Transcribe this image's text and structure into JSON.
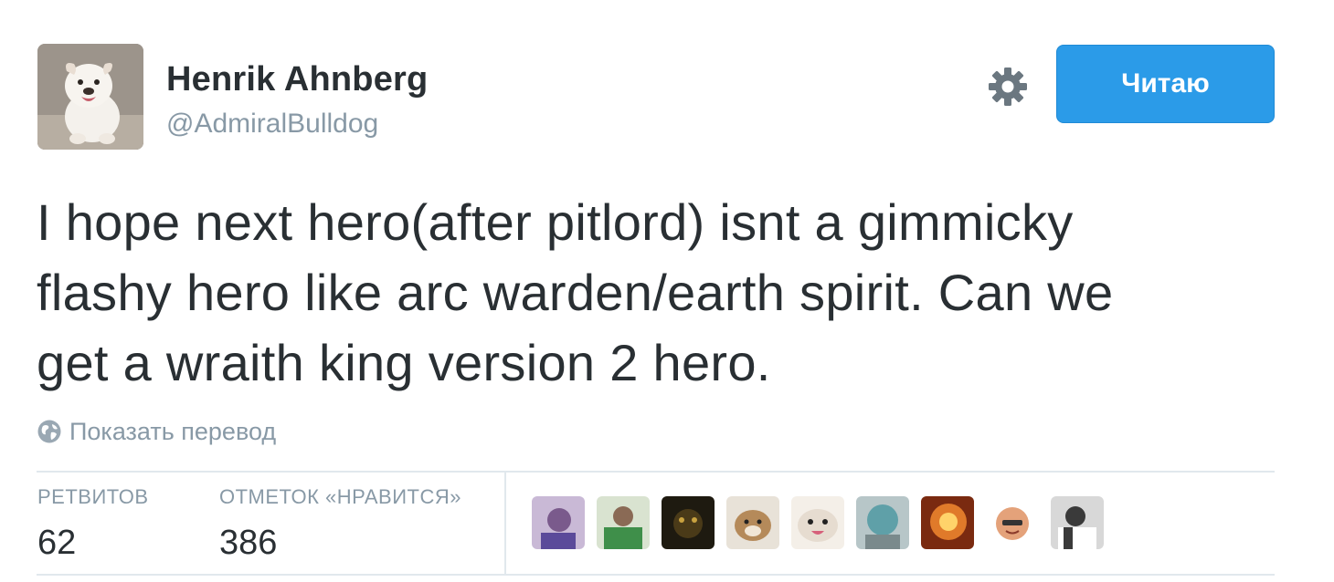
{
  "user": {
    "full_name": "Henrik Ahnberg",
    "username": "@AdmiralBulldog",
    "avatar_icon": "bulldog-avatar"
  },
  "actions": {
    "settings_icon": "gear-icon",
    "follow_label": "Читаю"
  },
  "tweet": {
    "lines": [
      "I hope next hero(after pitlord) isnt a gimmicky",
      "flashy hero like arc warden/earth spirit. Can we",
      "get a wraith king version 2 hero."
    ],
    "translate_label": "Показать перевод",
    "translate_icon": "globe-icon"
  },
  "stats": {
    "retweets_label": "РЕТВИТОВ",
    "retweets_value": "62",
    "likes_label": "ОТМЕТОК «НРАВИТСЯ»",
    "likes_value": "386"
  },
  "likers": [
    {
      "name": "liker-avatar",
      "color": "#7a5a8c"
    },
    {
      "name": "liker-avatar",
      "color": "#3f8f4a"
    },
    {
      "name": "liker-avatar",
      "color": "#4a3a18"
    },
    {
      "name": "liker-avatar",
      "color": "#b58a5a"
    },
    {
      "name": "liker-avatar",
      "color": "#e6dcd0"
    },
    {
      "name": "liker-avatar",
      "color": "#5fa0a8"
    },
    {
      "name": "liker-avatar",
      "color": "#e07a2a"
    },
    {
      "name": "liker-avatar",
      "color": "#ffffff"
    },
    {
      "name": "liker-avatar",
      "color": "#3a3a3a"
    }
  ],
  "colors": {
    "accent": "#2b9be8",
    "text": "#292f33",
    "muted": "#8899a6",
    "divider": "#e1e8ed"
  }
}
